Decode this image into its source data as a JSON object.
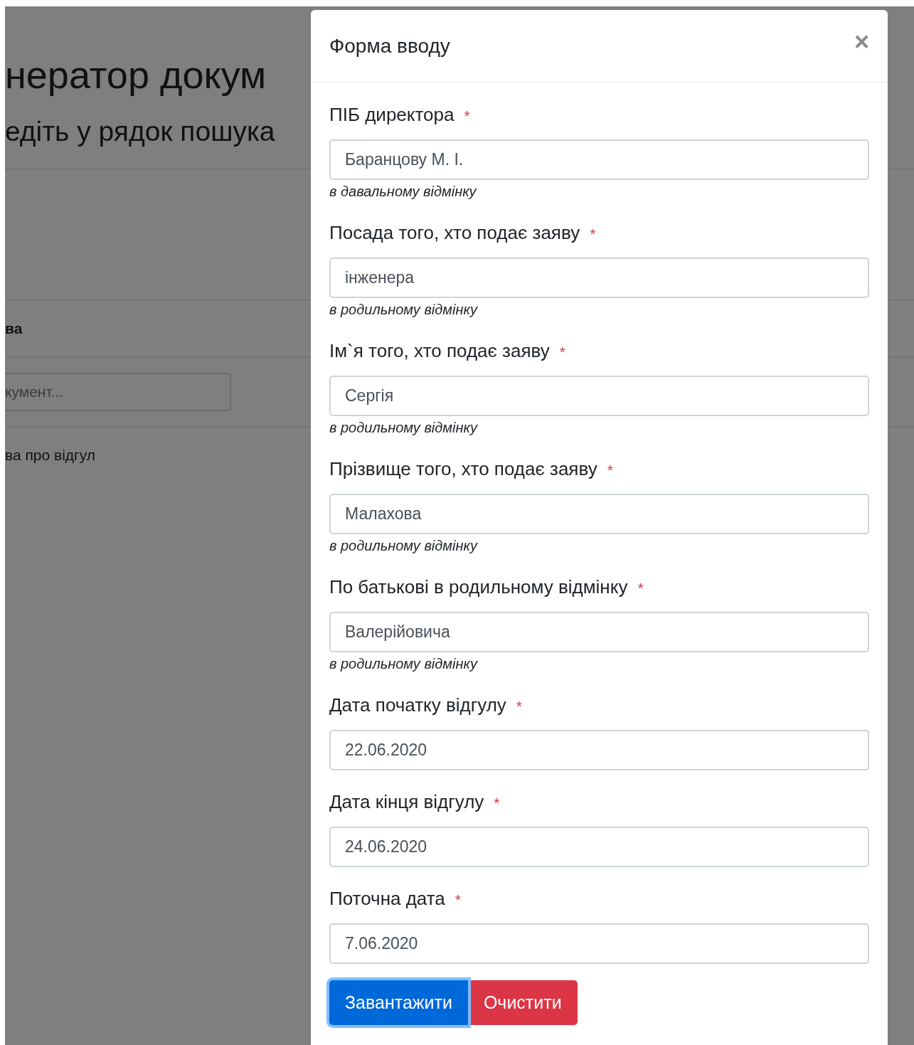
{
  "background": {
    "title": "нератор докум",
    "subtitle": "едіть у рядок пошука",
    "section_heading": "ва",
    "search": {
      "placeholder": "кумент..."
    },
    "result": "ва про відгул"
  },
  "modal": {
    "title": "Форма вводу",
    "close": "×",
    "fields": [
      {
        "label": "ПІБ директора",
        "required_mark": "*",
        "value": "Баранцову М. І.",
        "hint": "в давальному відмінку"
      },
      {
        "label": "Посада того, хто подає заяву",
        "required_mark": "*",
        "value": "інженера",
        "hint": "в родильному відмінку"
      },
      {
        "label": "Ім`я того, хто подає заяву",
        "required_mark": "*",
        "value": "Сергія",
        "hint": "в родильному відмінку"
      },
      {
        "label": "Прізвище того, хто подає заяву",
        "required_mark": "*",
        "value": "Малахова",
        "hint": "в родильному відмінку"
      },
      {
        "label": "По батькові в родильному відмінку",
        "required_mark": "*",
        "value": "Валерійовича",
        "hint": "в родильному відмінку"
      },
      {
        "label": "Дата початку відгулу",
        "required_mark": "*",
        "value": "22.06.2020"
      },
      {
        "label": "Дата кінця відгулу",
        "required_mark": "*",
        "value": "24.06.2020"
      },
      {
        "label": "Поточна дата",
        "required_mark": "*",
        "value": "7.06.2020"
      }
    ],
    "buttons": [
      {
        "label": "Завантажити",
        "kind": "primary",
        "focused": true
      },
      {
        "label": "Очистити",
        "kind": "danger",
        "focused": false
      }
    ]
  }
}
